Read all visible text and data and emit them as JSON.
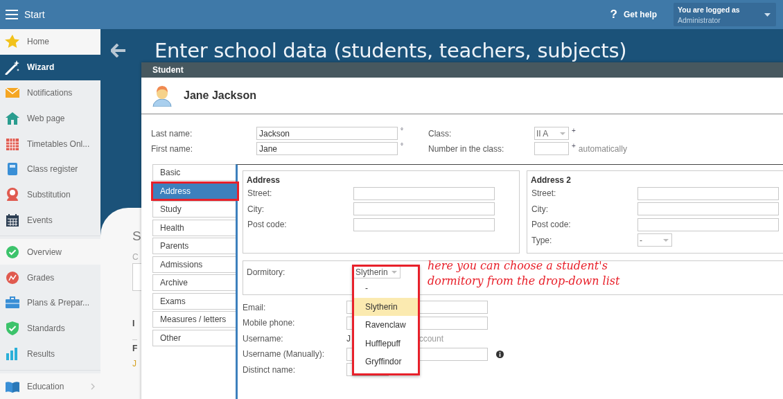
{
  "top_bar": {
    "menu_label": "Start",
    "help_mark": "?",
    "help_label": "Get help",
    "login": {
      "caption": "You are logged as",
      "user": "Administrator"
    }
  },
  "sidebar": {
    "groups": [
      [
        {
          "label": "Home",
          "selected": false,
          "submenu": false
        },
        {
          "label": "Wizard",
          "selected": true,
          "submenu": false
        },
        {
          "label": "Notifications",
          "selected": false,
          "submenu": false
        },
        {
          "label": "Web page",
          "selected": false,
          "submenu": false
        },
        {
          "label": "Timetables Onl...",
          "selected": false,
          "submenu": false
        },
        {
          "label": "Class register",
          "selected": false,
          "submenu": false
        },
        {
          "label": "Substitution",
          "selected": false,
          "submenu": false
        },
        {
          "label": "Events",
          "selected": false,
          "submenu": false
        }
      ],
      [
        {
          "label": "Overview",
          "selected": false,
          "submenu": false
        },
        {
          "label": "Grades",
          "selected": false,
          "submenu": false
        },
        {
          "label": "Plans & Prepar...",
          "selected": false,
          "submenu": false
        },
        {
          "label": "Standards",
          "selected": false,
          "submenu": false
        },
        {
          "label": "Results",
          "selected": false,
          "submenu": false
        }
      ],
      [
        {
          "label": "Education",
          "selected": false,
          "submenu": true
        }
      ]
    ]
  },
  "page": {
    "title": "Enter school data (students, teachers, subjects)",
    "background": {
      "heading": "S",
      "label": "C",
      "section": "I",
      "column": "F",
      "cell": "J"
    }
  },
  "dialog": {
    "title": "Student",
    "name": "Jane Jackson",
    "fields_left": [
      {
        "label": "Last name:",
        "value": "Jackson",
        "mark": "°"
      },
      {
        "label": "First name:",
        "value": "Jane",
        "mark": "°"
      }
    ],
    "fields_right": [
      {
        "label": "Class:",
        "kind": "select",
        "value": "II A",
        "mark": "+"
      },
      {
        "label": "Number in the class:",
        "kind": "input",
        "mark": "+",
        "note": "automatically"
      }
    ],
    "tabs": [
      {
        "label": "Basic",
        "selected": false
      },
      {
        "label": "Address",
        "selected": true
      },
      {
        "label": "Study",
        "selected": false
      },
      {
        "label": "Health",
        "selected": false
      },
      {
        "label": "Parents",
        "selected": false
      },
      {
        "label": "Admissions",
        "selected": false
      },
      {
        "label": "Archive",
        "selected": false
      },
      {
        "label": "Exams",
        "selected": false
      },
      {
        "label": "Measures / letters",
        "selected": false
      },
      {
        "label": "Other",
        "selected": false
      }
    ],
    "address": {
      "title": "Address",
      "fields": [
        {
          "label": "Street:",
          "kind": "input"
        },
        {
          "label": "City:",
          "kind": "input"
        },
        {
          "label": "Post code:",
          "kind": "input"
        }
      ]
    },
    "address2": {
      "title": "Address 2",
      "fields": [
        {
          "label": "Street:",
          "kind": "input"
        },
        {
          "label": "City:",
          "kind": "input"
        },
        {
          "label": "Post code:",
          "kind": "input"
        },
        {
          "label": "Type:",
          "kind": "select",
          "value": "-"
        }
      ]
    },
    "dormitory": {
      "label": "Dormitory:",
      "value": "Slytherin",
      "open": true,
      "options": [
        {
          "label": "-",
          "selected": false
        },
        {
          "label": "Slytherin",
          "selected": true
        },
        {
          "label": "Ravenclaw",
          "selected": false
        },
        {
          "label": "Hufflepuff",
          "selected": false
        },
        {
          "label": "Gryffindor",
          "selected": false
        }
      ]
    },
    "contact_fields": [
      {
        "label": "Email:",
        "kind": "input"
      },
      {
        "label": "Mobile phone:",
        "kind": "input"
      },
      {
        "label": "Username:",
        "kind": "text",
        "value_parts": [
          "J",
          "ccount"
        ]
      },
      {
        "label": "Username (Manually):",
        "kind": "input",
        "info": true
      },
      {
        "label": "Distinct name:",
        "kind": "short_input"
      }
    ]
  },
  "annotation": {
    "lines": [
      "here you can choose a student's",
      "dormitory from the drop-down list"
    ]
  }
}
